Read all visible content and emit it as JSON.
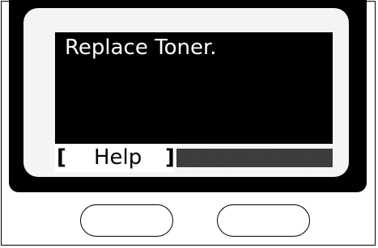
{
  "display": {
    "message": "Replace Toner.",
    "softkey": {
      "left_bracket": "[",
      "label": "Help",
      "right_bracket": "]"
    }
  },
  "colors": {
    "lcd_background": "#000000",
    "lcd_text": "#ffffff",
    "softkey_background": "#ffffff",
    "bezel": "#000000",
    "inset_frame": "#f4f4f4"
  },
  "hardware_buttons": [
    {
      "name": "left-softkey-button"
    },
    {
      "name": "right-softkey-button"
    }
  ]
}
